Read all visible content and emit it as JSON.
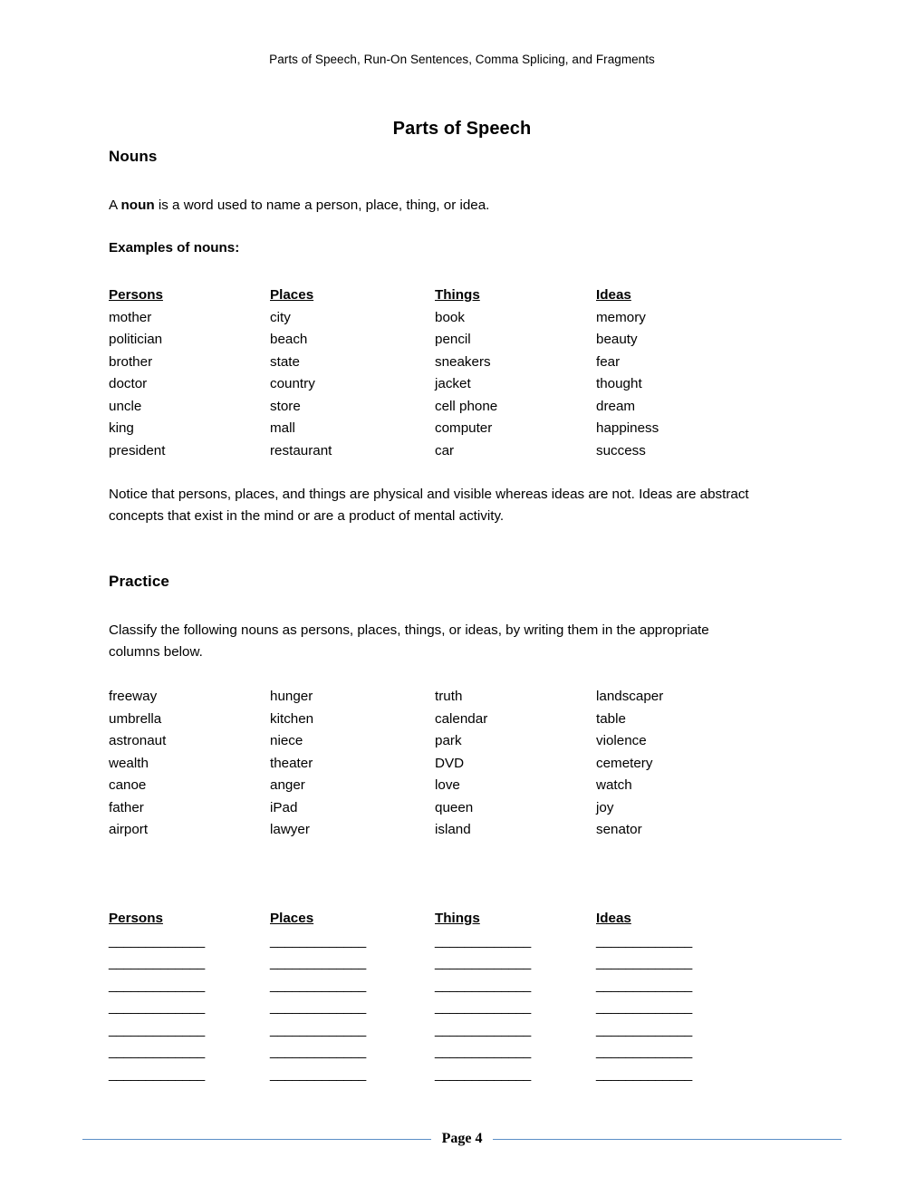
{
  "header": {
    "running_title": "Parts of Speech, Run-On Sentences, Comma Splicing, and Fragments"
  },
  "title": "Parts of Speech",
  "sections": {
    "nouns": {
      "heading": "Nouns",
      "definition_prefix": "A ",
      "definition_bold": "noun",
      "definition_suffix": " is a word used to name a person, place, thing, or idea.",
      "examples_label": "Examples of nouns:",
      "columns": [
        {
          "header": "Persons",
          "items": [
            "mother",
            "politician",
            "brother",
            "doctor",
            "uncle",
            "king",
            "president"
          ]
        },
        {
          "header": "Places",
          "items": [
            "city",
            "beach",
            "state",
            "country",
            "store",
            "mall",
            "restaurant"
          ]
        },
        {
          "header": "Things",
          "items": [
            "book",
            "pencil",
            "sneakers",
            "jacket",
            "cell phone",
            "computer",
            "car"
          ]
        },
        {
          "header": "Ideas",
          "items": [
            "memory",
            "beauty",
            "fear",
            "thought",
            "dream",
            "happiness",
            "success"
          ]
        }
      ],
      "note_line_1": "Notice that persons, places, and things are physical and visible whereas ideas are not.",
      "note_line_2": "Ideas are abstract concepts that exist in the mind or are a product of mental activity."
    },
    "practice": {
      "heading": "Practice",
      "instructions_line_1": "Classify the following nouns as persons, places, things, or ideas, by writing them in the",
      "instructions_line_2": "appropriate columns below.",
      "word_columns": [
        {
          "items": [
            "freeway",
            "umbrella",
            "astronaut",
            "wealth",
            "canoe",
            "father",
            "airport"
          ]
        },
        {
          "items": [
            "hunger",
            "kitchen",
            "niece",
            "theater",
            "anger",
            "iPad",
            "lawyer"
          ]
        },
        {
          "items": [
            "truth",
            "calendar",
            "park",
            "DVD",
            "love",
            "queen",
            "island"
          ]
        },
        {
          "items": [
            "landscaper",
            "table",
            "violence",
            "cemetery",
            "watch",
            "joy",
            "senator"
          ]
        }
      ],
      "answer_columns": [
        {
          "header": "Persons"
        },
        {
          "header": "Places"
        },
        {
          "header": "Things"
        },
        {
          "header": "Ideas"
        }
      ],
      "blank_line": "_____________",
      "blank_rows": 7
    }
  },
  "footer": {
    "page_label": "Page 4"
  },
  "colors": {
    "footer_rule": "#5B8FC7",
    "text": "#000000",
    "page_background": "#FFFFFF"
  }
}
